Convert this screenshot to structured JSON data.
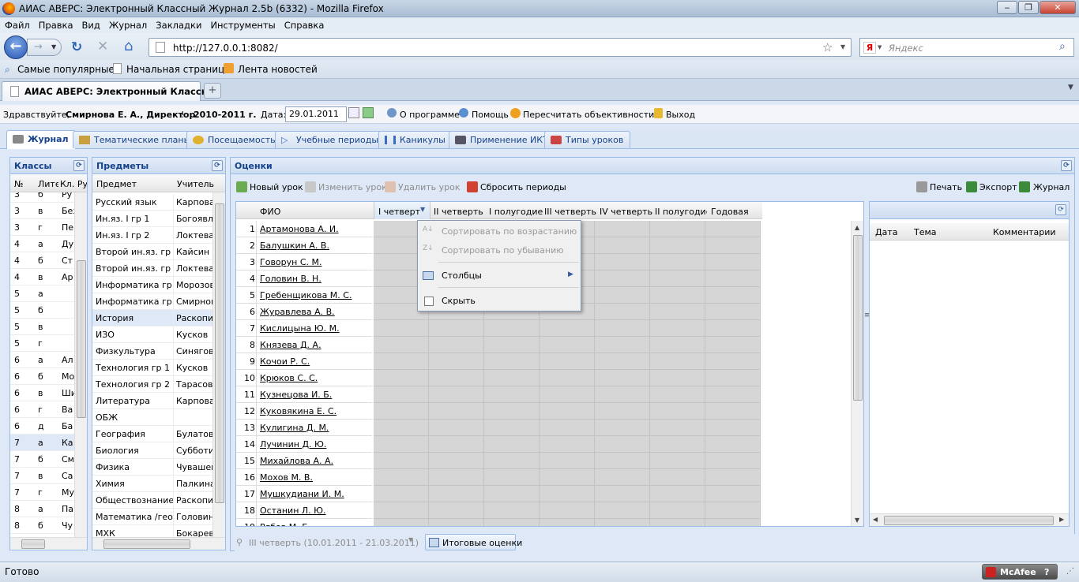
{
  "window": {
    "title": "АИАС АВЕРС: Электронный Классный Журнал 2.5b (6332) - Mozilla Firefox"
  },
  "menu": [
    "Файл",
    "Правка",
    "Вид",
    "Журнал",
    "Закладки",
    "Инструменты",
    "Справка"
  ],
  "nav": {
    "url": "http://127.0.0.1:8082/",
    "search_placeholder": "Яндекс",
    "search_engine": "Я"
  },
  "bookmarks": [
    "Самые популярные",
    "Начальная страница",
    "Лента новостей"
  ],
  "browser_tab": {
    "title": "АИАС АВЕРС: Электронный Классн...",
    "new_tab": "+"
  },
  "info": {
    "greeting_prefix": "Здравствуйте,",
    "user": "Смирнова Е. А., Директор",
    "greeting_suffix": "!",
    "year": "2010-2011 г.",
    "date_label": "Дата:",
    "date_value": "29.01.2011",
    "about": "О программе",
    "help": "Помощь",
    "recalc": "Пересчитать объективности",
    "logout": "Выход"
  },
  "app_tabs": [
    "Журнал",
    "Тематические планы",
    "Посещаемость",
    "Учебные периоды",
    "Каникулы",
    "Применение ИКТ",
    "Типы уроков"
  ],
  "classes": {
    "title": "Классы",
    "columns": [
      "№",
      "Лите",
      "Кл. Ру"
    ],
    "rows": [
      [
        "3",
        "б",
        "Ру"
      ],
      [
        "3",
        "в",
        "Без"
      ],
      [
        "3",
        "г",
        "Пер"
      ],
      [
        "4",
        "а",
        "Ду"
      ],
      [
        "4",
        "б",
        "Ст"
      ],
      [
        "4",
        "в",
        "Ар"
      ],
      [
        "5",
        "а",
        ""
      ],
      [
        "5",
        "б",
        ""
      ],
      [
        "5",
        "в",
        ""
      ],
      [
        "5",
        "г",
        ""
      ],
      [
        "6",
        "а",
        "Ал"
      ],
      [
        "6",
        "б",
        "Мо"
      ],
      [
        "6",
        "в",
        "Ши"
      ],
      [
        "6",
        "г",
        "Ва"
      ],
      [
        "6",
        "д",
        "Ба"
      ],
      [
        "7",
        "а",
        "Ка"
      ],
      [
        "7",
        "б",
        "См"
      ],
      [
        "7",
        "в",
        "Са"
      ],
      [
        "7",
        "г",
        "Му"
      ],
      [
        "8",
        "а",
        "Па"
      ],
      [
        "8",
        "б",
        "Чу"
      ]
    ],
    "selected_index": 15
  },
  "subjects": {
    "title": "Предметы",
    "columns": [
      "Предмет",
      "Учитель"
    ],
    "rows": [
      [
        "Русский язык",
        "Карпова"
      ],
      [
        "Ин.яз. I гр 1",
        "Богоявле"
      ],
      [
        "Ин.яз. I гр 2",
        "Локтева"
      ],
      [
        "Второй ин.яз. гр 1",
        "Кайсин"
      ],
      [
        "Второй ин.яз. гр 2",
        "Локтева"
      ],
      [
        "Информатика гр 1",
        "Морозова"
      ],
      [
        "Информатика гр 2",
        "Смирнова"
      ],
      [
        "История",
        "Раскопин"
      ],
      [
        "ИЗО",
        "Кусков"
      ],
      [
        "Физкультура",
        "Синяговс"
      ],
      [
        "Технология гр 1",
        "Кусков"
      ],
      [
        "Технология гр 2",
        "Тарасова"
      ],
      [
        "Литература",
        "Карпова"
      ],
      [
        "ОБЖ",
        ""
      ],
      [
        "География",
        "Булатова"
      ],
      [
        "Биология",
        "Субботин"
      ],
      [
        "Физика",
        "Чувашев"
      ],
      [
        "Химия",
        "Палкина"
      ],
      [
        "Обществознание",
        "Раскопин"
      ],
      [
        "Математика /геоме",
        "Головина"
      ],
      [
        "МХК",
        "Бокарев"
      ]
    ],
    "selected_index": 7
  },
  "grades": {
    "title": "Оценки",
    "toolbar": {
      "new_lesson": "Новый урок",
      "edit_lesson": "Изменить урок",
      "delete_lesson": "Удалить урок",
      "reset_periods": "Сбросить периоды",
      "print": "Печать",
      "export": "Экспорт",
      "journal": "Журнал"
    },
    "columns": [
      "ФИО",
      "I четверт",
      "II четверть",
      "I полугодие",
      "III четверть",
      "IV четверть",
      "II полугодие",
      "Годовая"
    ],
    "students": [
      "Артамонова А. И.",
      "Балушкин А. В.",
      "Говорун С. М.",
      "Головин В. Н.",
      "Гребенщикова М. С.",
      "Журавлева А. В.",
      "Кислицына Ю. М.",
      "Князева Д. А.",
      "Кочои Р. С.",
      "Крюков С. С.",
      "Кузнецова И. Б.",
      "Куковякина Е. С.",
      "Кулигина Д. М.",
      "Лучинин Д. Ю.",
      "Михайлова А. А.",
      "Мохов М. В.",
      "Мушкудиани И. М.",
      "Останин Л. Ю.",
      "Рябов М. Б."
    ]
  },
  "context_menu": {
    "sort_asc": "Сортировать по возрастанию",
    "sort_desc": "Сортировать по убыванию",
    "columns": "Столбцы",
    "hide": "Скрыть"
  },
  "lessons": {
    "columns": [
      "Дата",
      "Тема",
      "Комментарии"
    ]
  },
  "bottom": {
    "period": "III четверть (10.01.2011 - 21.03.2011)",
    "final_grades": "Итоговые оценки"
  },
  "status": {
    "text": "Готово",
    "mcafee": "McAfee"
  },
  "colors": {
    "accent": "#15428b",
    "panel_border": "#99bbe8",
    "cell_gray": "#d6d6d6"
  }
}
